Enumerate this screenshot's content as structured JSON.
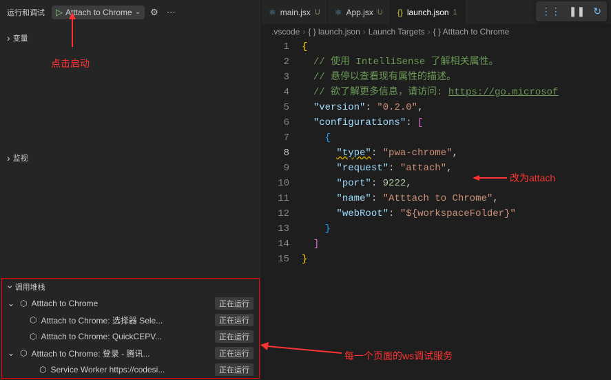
{
  "header": {
    "title": "运行和调试",
    "config_name": "Atttach to Chrome"
  },
  "sections": {
    "variables": "变量",
    "watch": "监视",
    "call_stack": "调用堆栈"
  },
  "call_stack_items": [
    {
      "label": "Atttach to Chrome",
      "badge": "正在运行",
      "expanded": true,
      "indent": 0
    },
    {
      "label": "Atttach to Chrome: 选择器 Sele...",
      "badge": "正在运行",
      "indent": 1
    },
    {
      "label": "Atttach to Chrome: QuickCEPV...",
      "badge": "正在运行",
      "indent": 1
    },
    {
      "label": "Atttach to Chrome: 登录 - 腾讯...",
      "badge": "正在运行",
      "expanded": true,
      "indent": 0
    },
    {
      "label": "Service Worker https://codesi...",
      "badge": "正在运行",
      "indent": 2
    }
  ],
  "tabs": [
    {
      "icon": "⚛",
      "name": "main.jsx",
      "mod": "U",
      "type": "jsx"
    },
    {
      "icon": "⚛",
      "name": "App.jsx",
      "mod": "U",
      "type": "jsx"
    },
    {
      "icon": "{}",
      "name": "launch.json",
      "mod": "1",
      "type": "json",
      "active": true
    }
  ],
  "breadcrumb": {
    "parts": [
      ".vscode",
      "{ } launch.json",
      "Launch Targets",
      "{ } Atttach to Chrome"
    ]
  },
  "code": {
    "lines": [
      {
        "n": 1,
        "html": "<span class='p'>{</span>"
      },
      {
        "n": 2,
        "html": "  <span class='c'>// 使用 IntelliSense 了解相关属性。</span>"
      },
      {
        "n": 3,
        "html": "  <span class='c'>// 悬停以查看现有属性的描述。</span>"
      },
      {
        "n": 4,
        "html": "  <span class='c'>// 欲了解更多信息，请访问: <span class='u'>https://go.microsof</span></span>"
      },
      {
        "n": 5,
        "html": "  <span class='k'>\"version\"</span>: <span class='s'>\"0.2.0\"</span>,"
      },
      {
        "n": 6,
        "html": "  <span class='k'>\"configurations\"</span>: <span class='p2'>[</span>"
      },
      {
        "n": 7,
        "html": "    <span class='p3'>{</span>"
      },
      {
        "n": 8,
        "html": "      <span class='k underline-warn'>\"type\"</span>: <span class='s'>\"pwa-chrome\"</span>,",
        "current": true
      },
      {
        "n": 9,
        "html": "      <span class='k'>\"request\"</span>: <span class='s'>\"attach\"</span>,"
      },
      {
        "n": 10,
        "html": "      <span class='k'>\"port\"</span>: <span class='n'>9222</span>,"
      },
      {
        "n": 11,
        "html": "      <span class='k'>\"name\"</span>: <span class='s'>\"Atttach to Chrome\"</span>,"
      },
      {
        "n": 12,
        "html": "      <span class='k'>\"webRoot\"</span>: <span class='s'>\"${workspaceFolder}\"</span>"
      },
      {
        "n": 13,
        "html": "    <span class='p3'>}</span>"
      },
      {
        "n": 14,
        "html": "  <span class='p2'>]</span>"
      },
      {
        "n": 15,
        "html": "<span class='p'>}</span>"
      }
    ]
  },
  "annotations": {
    "click_start": "点击启动",
    "change_to_attach": "改为attach",
    "ws_debug_service": "每一个页面的ws调试服务"
  }
}
